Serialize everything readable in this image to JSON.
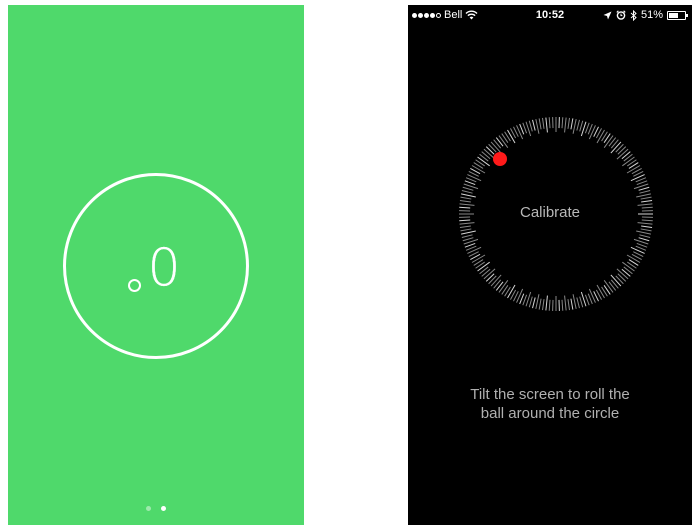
{
  "left_screen": {
    "level_readout": "0",
    "page_indicator": {
      "count": 2,
      "active_index": 1
    }
  },
  "right_screen": {
    "status_bar": {
      "carrier": "Bell",
      "signal_bars_filled": 4,
      "signal_bars_total": 5,
      "time": "10:52",
      "battery": "51%",
      "icons": [
        "wifi-icon",
        "location-icon",
        "alarm-icon",
        "bluetooth-icon",
        "battery-icon"
      ]
    },
    "calibrate_label": "Calibrate",
    "instruction_line1": "Tilt the screen to roll the",
    "instruction_line2": "ball around the circle",
    "colors": {
      "ball": "#ff1a1a",
      "ticks": "#d9d9d9",
      "background": "#000000"
    }
  },
  "colors": {
    "green_bg": "#4fd96b"
  }
}
